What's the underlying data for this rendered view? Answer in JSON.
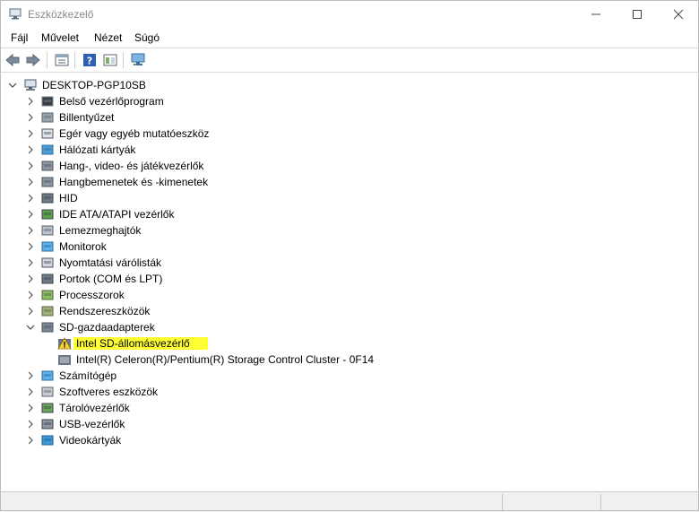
{
  "window": {
    "title": "Eszközkezelő",
    "minimize_icon": "minimize-icon",
    "maximize_icon": "maximize-icon",
    "close_icon": "close-icon"
  },
  "menu": {
    "items": [
      {
        "label": "Fájl"
      },
      {
        "label": "Művelet"
      },
      {
        "label": "Nézet"
      },
      {
        "label": "Súgó"
      }
    ]
  },
  "toolbar": {
    "icons": [
      "back-arrow-icon",
      "forward-arrow-icon",
      "properties-icon",
      "help-icon",
      "view-icon",
      "scan-hardware-icon"
    ]
  },
  "tree": {
    "root": {
      "label": "DESKTOP-PGP10SB",
      "icon": "computer-icon",
      "expanded": true
    },
    "categories": [
      {
        "label": "Belső vezérlőprogram",
        "icon": "firmware-icon"
      },
      {
        "label": "Billentyűzet",
        "icon": "keyboard-icon"
      },
      {
        "label": "Egér vagy egyéb mutatóeszköz",
        "icon": "mouse-icon"
      },
      {
        "label": "Hálózati kártyák",
        "icon": "network-adapter-icon"
      },
      {
        "label": "Hang-, video- és játékvezérlők",
        "icon": "sound-icon"
      },
      {
        "label": "Hangbemenetek és -kimenetek",
        "icon": "audio-io-icon"
      },
      {
        "label": "HID",
        "icon": "hid-icon"
      },
      {
        "label": "IDE ATA/ATAPI vezérlők",
        "icon": "ide-controller-icon"
      },
      {
        "label": "Lemezmeghajtók",
        "icon": "disk-drive-icon"
      },
      {
        "label": "Monitorok",
        "icon": "monitor-icon"
      },
      {
        "label": "Nyomtatási várólisták",
        "icon": "printer-icon"
      },
      {
        "label": "Portok (COM és LPT)",
        "icon": "port-icon"
      },
      {
        "label": "Processzorok",
        "icon": "processor-icon"
      },
      {
        "label": "Rendszereszközök",
        "icon": "system-device-icon"
      },
      {
        "label": "SD-gazdaadapterek",
        "icon": "sd-host-icon",
        "expanded": true,
        "children": [
          {
            "label": "Intel SD-állomásvezérlő",
            "icon": "warning-icon",
            "highlight": true
          },
          {
            "label": "Intel(R) Celeron(R)/Pentium(R) Storage Control Cluster  - 0F14",
            "icon": "sd-host-icon"
          }
        ]
      },
      {
        "label": "Számítógép",
        "icon": "computer-icon"
      },
      {
        "label": "Szoftveres eszközök",
        "icon": "software-device-icon"
      },
      {
        "label": "Tárolóvezérlők",
        "icon": "storage-controller-icon"
      },
      {
        "label": "USB-vezérlők",
        "icon": "usb-icon"
      },
      {
        "label": "Videokártyák",
        "icon": "display-adapter-icon"
      }
    ]
  },
  "colors": {
    "highlight": "#ffff33",
    "status_bar": "#f0f0f0"
  }
}
